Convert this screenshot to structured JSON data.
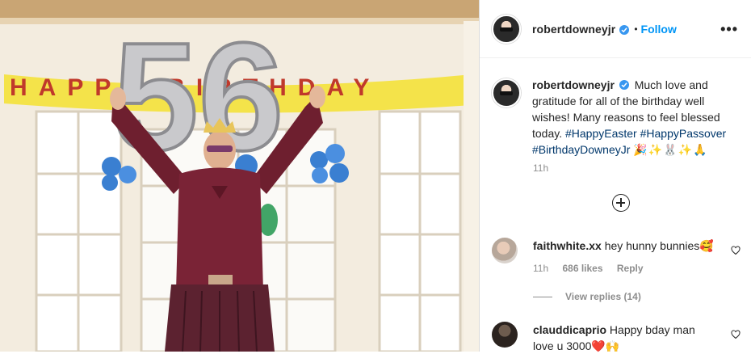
{
  "post": {
    "author": "robertdowneyjr",
    "separator": "•",
    "follow_label": "Follow",
    "more_label": "•••",
    "balloon_number": "56",
    "banner_text": "HAPPY BIRTHDAY"
  },
  "caption": {
    "username": "robertdowneyjr",
    "text": "Much love and gratitude for all of the birthday well wishes! Many reasons to feel blessed today.",
    "hashtags": [
      "#HappyEaster",
      "#HappyPassover",
      "#BirthdayDowneyJr"
    ],
    "emojis": "🎉✨🐰✨🙏",
    "time": "11h"
  },
  "comments": [
    {
      "username": "faithwhite.xx",
      "text": "hey hunny bunnies🥰",
      "time": "11h",
      "likes": "686 likes",
      "reply_label": "Reply",
      "view_replies": "View replies (14)"
    },
    {
      "username": "clauddicaprio",
      "text": "Happy bday man love u 3000❤️🙌"
    }
  ],
  "icons": {
    "verified": "verified-badge-icon",
    "more": "more-options-icon",
    "load_more": "plus-circle-icon",
    "like": "heart-icon"
  },
  "colors": {
    "link_blue": "#0095f6",
    "hashtag": "#00376b",
    "muted": "#8e8e8e",
    "verified": "#3897f0"
  }
}
